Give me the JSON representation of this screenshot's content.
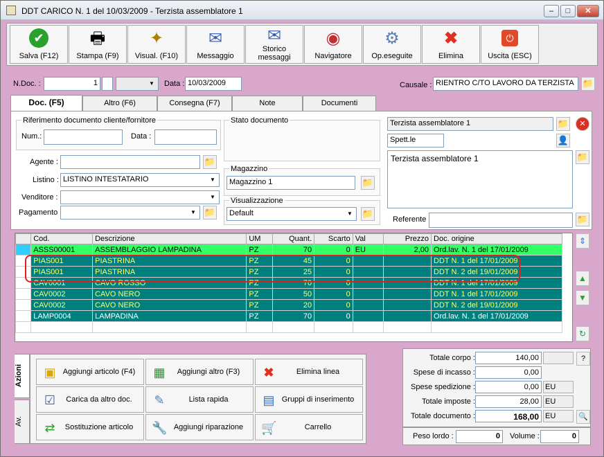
{
  "window": {
    "title": "DDT CARICO N. 1  del 10/03/2009 - Terzista assemblatore 1"
  },
  "toolbar": [
    {
      "label": "Salva (F12)",
      "icon": "check-icon"
    },
    {
      "label": "Stampa (F9)",
      "icon": "printer-icon"
    },
    {
      "label": "Visual. (F10)",
      "icon": "magic-wand-icon"
    },
    {
      "label": "Messaggio",
      "icon": "message-icon"
    },
    {
      "label": "Storico messaggi",
      "icon": "message-history-icon"
    },
    {
      "label": "Navigatore",
      "icon": "navigator-icon"
    },
    {
      "label": "Op.eseguite",
      "icon": "gears-icon"
    },
    {
      "label": "Elimina",
      "icon": "delete-x-icon"
    },
    {
      "label": "Uscita (ESC)",
      "icon": "exit-icon"
    }
  ],
  "header": {
    "ndoc_label": "N.Doc. :",
    "ndoc_value": "1",
    "data_label": "Data :",
    "data_value": "10/03/2009",
    "causale_label": "Causale :",
    "causale_value": "RIENTRO C/TO LAVORO DA TERZISTA"
  },
  "tabs": [
    "Doc. (F5)",
    "Altro (F6)",
    "Consegna (F7)",
    "Note",
    "Documenti"
  ],
  "doc": {
    "rif_label": "Riferimento documento cliente/fornitore",
    "num_label": "Num.:",
    "num_value": "",
    "data_label": "Data :",
    "data_value": "",
    "stato_label": "Stato documento",
    "agente_label": "Agente :",
    "agente_value": "",
    "listino_label": "Listino :",
    "listino_value": "LISTINO INTESTATARIO",
    "venditore_label": "Venditore :",
    "venditore_value": "",
    "pagamento_label": "Pagamento :",
    "pagamento_value": "",
    "magazzino_label": "Magazzino",
    "magazzino_value": "Magazzino 1",
    "visualizzazione_label": "Visualizzazione",
    "visualizzazione_value": "Default",
    "intestatario": "Terzista assemblatore 1",
    "spett": "Spett.le",
    "indirizzo": "Terzista assemblatore 1",
    "referente_label": "Referente",
    "referente_value": ""
  },
  "grid": {
    "headers": [
      "Cod.",
      "Descrizione",
      "UM",
      "Quant.",
      "Scarto",
      "Val",
      "Prezzo",
      "Doc. origine"
    ],
    "rows": [
      {
        "cod": "ASSS00001",
        "desc": "ASSEMBLAGGIO LAMPADINA",
        "um": "PZ",
        "quant": "70",
        "scarto": "0",
        "val": "EU",
        "prezzo": "2,00",
        "origine": "Ord.lav. N. 1 del 17/01/2009"
      },
      {
        "cod": "PIAS001",
        "desc": "PIASTRINA",
        "um": "PZ",
        "quant": "45",
        "scarto": "0",
        "val": "",
        "prezzo": "",
        "origine": "DDT N. 1 del 17/01/2009"
      },
      {
        "cod": "PIAS001",
        "desc": "PIASTRINA",
        "um": "PZ",
        "quant": "25",
        "scarto": "0",
        "val": "",
        "prezzo": "",
        "origine": "DDT N. 2 del 19/01/2009"
      },
      {
        "cod": "CAV0001",
        "desc": "CAVO ROSSO",
        "um": "PZ",
        "quant": "70",
        "scarto": "0",
        "val": "",
        "prezzo": "",
        "origine": "DDT N. 1 del 17/01/2009"
      },
      {
        "cod": "CAV0002",
        "desc": "CAVO NERO",
        "um": "PZ",
        "quant": "50",
        "scarto": "0",
        "val": "",
        "prezzo": "",
        "origine": "DDT N. 1 del 17/01/2009"
      },
      {
        "cod": "CAV0002",
        "desc": "CAVO NERO",
        "um": "PZ",
        "quant": "20",
        "scarto": "0",
        "val": "",
        "prezzo": "",
        "origine": "DDT N. 2 del 19/01/2009"
      },
      {
        "cod": "LAMP0004",
        "desc": "LAMPADINA",
        "um": "PZ",
        "quant": "70",
        "scarto": "0",
        "val": "",
        "prezzo": "",
        "origine": "Ord.lav. N. 1 del 17/01/2009"
      }
    ]
  },
  "actions": {
    "side_tabs": [
      "Azioni",
      "Av."
    ],
    "buttons": [
      {
        "label": "Aggiungi articolo (F4)",
        "icon": "add-article-icon"
      },
      {
        "label": "Aggiungi altro (F3)",
        "icon": "add-other-icon"
      },
      {
        "label": "Elimina linea",
        "icon": "delete-line-icon"
      },
      {
        "label": "Carica da altro doc.",
        "icon": "load-doc-icon"
      },
      {
        "label": "Lista rapida",
        "icon": "quick-list-icon"
      },
      {
        "label": "Gruppi di inserimento",
        "icon": "insert-groups-icon"
      },
      {
        "label": "Sostituzione articolo",
        "icon": "replace-article-icon"
      },
      {
        "label": "Aggiungi riparazione",
        "icon": "wrench-icon"
      },
      {
        "label": "Carrello",
        "icon": "cart-icon"
      }
    ]
  },
  "totals": [
    {
      "label": "Totale corpo :",
      "value": "140,00",
      "unit": ""
    },
    {
      "label": "Spese di incasso :",
      "value": "0,00",
      "unit": ""
    },
    {
      "label": "Spese spedizione :",
      "value": "0,00",
      "unit": "EU"
    },
    {
      "label": "Totale imposte :",
      "value": "28,00",
      "unit": "EU"
    },
    {
      "label": "Totale documento :",
      "value": "168,00",
      "unit": "EU"
    }
  ],
  "totals_help": "?",
  "weights": {
    "peso_label": "Peso lordo :",
    "peso_value": "0",
    "volume_label": "Volume :",
    "volume_value": "0"
  },
  "colors": {
    "accent": "#d9a7cc",
    "row_dark": "#007f7f",
    "row_green": "#33ff66",
    "row_text": "#ffff66",
    "highlight": "#e02020"
  }
}
